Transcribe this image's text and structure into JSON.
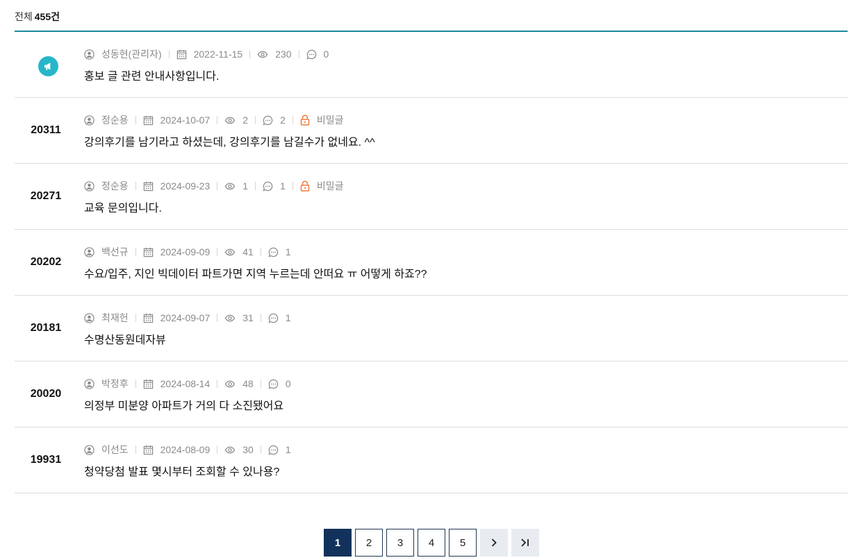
{
  "header": {
    "total_prefix": "전체",
    "total_count": "455건"
  },
  "posts": [
    {
      "num": "",
      "notice": true,
      "author": "성동현(관리자)",
      "date": "2022-11-15",
      "views": "230",
      "comments": "0",
      "secret": "",
      "title": "홍보 글 관련 안내사항입니다."
    },
    {
      "num": "20311",
      "notice": false,
      "author": "정순용",
      "date": "2024-10-07",
      "views": "2",
      "comments": "2",
      "secret": "비밀글",
      "title": "강의후기를 남기라고 하셨는데, 강의후기를 남길수가 없네요. ^^"
    },
    {
      "num": "20271",
      "notice": false,
      "author": "정순용",
      "date": "2024-09-23",
      "views": "1",
      "comments": "1",
      "secret": "비밀글",
      "title": "교육 문의입니다."
    },
    {
      "num": "20202",
      "notice": false,
      "author": "백선규",
      "date": "2024-09-09",
      "views": "41",
      "comments": "1",
      "secret": "",
      "title": "수요/입주, 지인 빅데이터 파트가면 지역 누르는데 안떠요 ㅠ 어떻게 하죠??"
    },
    {
      "num": "20181",
      "notice": false,
      "author": "최재헌",
      "date": "2024-09-07",
      "views": "31",
      "comments": "1",
      "secret": "",
      "title": "수명산동원데자뷰"
    },
    {
      "num": "20020",
      "notice": false,
      "author": "박정후",
      "date": "2024-08-14",
      "views": "48",
      "comments": "0",
      "secret": "",
      "title": "의정부 미분양 아파트가 거의 다 소진됐어요"
    },
    {
      "num": "19931",
      "notice": false,
      "author": "이선도",
      "date": "2024-08-09",
      "views": "30",
      "comments": "1",
      "secret": "",
      "title": "청약당첨 발표 몇시부터 조회할 수 있나용?"
    }
  ],
  "pagination": {
    "pages": [
      "1",
      "2",
      "3",
      "4",
      "5"
    ],
    "current": "1",
    "next_icon": "chevron-right-icon",
    "last_icon": "last-page-icon"
  },
  "colors": {
    "accent_line": "#1b8a9e",
    "notice_badge": "#27b6c9",
    "secret_lock": "#f07a3e",
    "active_page": "#13325b"
  }
}
